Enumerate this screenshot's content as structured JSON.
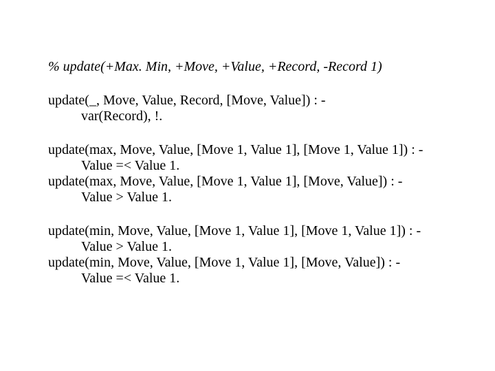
{
  "comment": "% update(+Max. Min, +Move, +Value, +Record, -Record 1)",
  "blocks": [
    {
      "lines": [
        {
          "cls": "clause-head",
          "text": "update(_, Move, Value, Record, [Move, Value]) : -"
        },
        {
          "cls": "clause-body",
          "text": "var(Record), !."
        }
      ]
    },
    {
      "lines": [
        {
          "cls": "clause-head",
          "text": "update(max, Move, Value, [Move 1, Value 1], [Move 1, Value 1]) : -"
        },
        {
          "cls": "clause-body",
          "text": "Value =< Value 1."
        },
        {
          "cls": "clause-head",
          "text": "update(max, Move, Value, [Move 1, Value 1],  [Move, Value]) : -"
        },
        {
          "cls": "clause-body",
          "text": "Value > Value 1."
        }
      ]
    },
    {
      "lines": [
        {
          "cls": "clause-head",
          "text": "update(min, Move, Value, [Move 1, Value 1], [Move 1, Value 1]) : -"
        },
        {
          "cls": "clause-body",
          "text": "Value > Value 1."
        },
        {
          "cls": "clause-head",
          "text": "update(min, Move, Value, [Move 1, Value 1], [Move, Value]) : -"
        },
        {
          "cls": "clause-body",
          "text": "Value =< Value 1."
        }
      ]
    }
  ]
}
